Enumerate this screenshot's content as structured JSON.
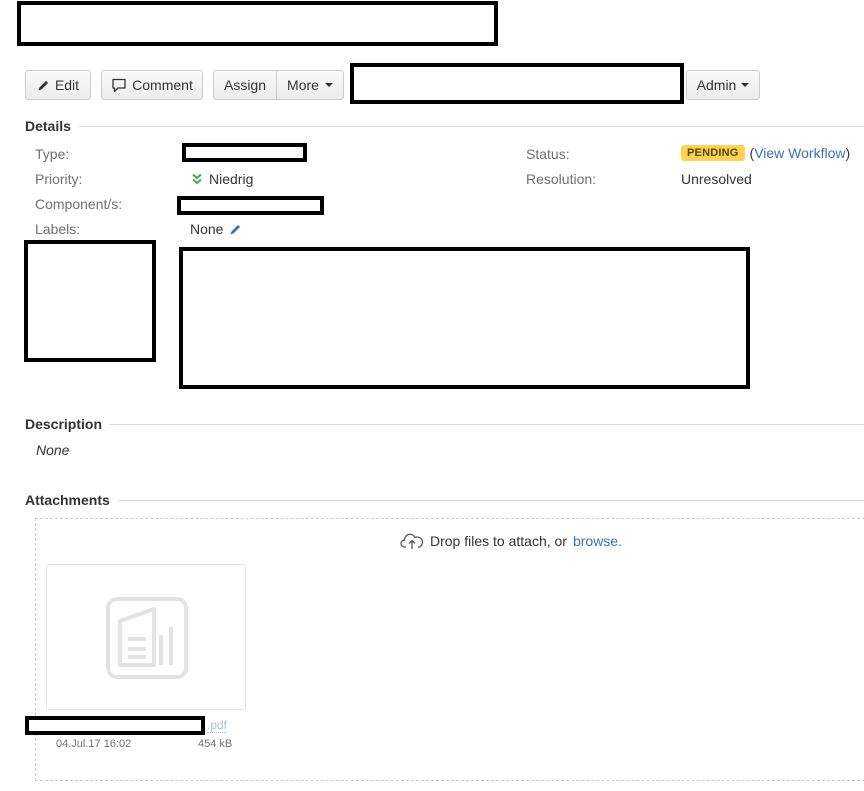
{
  "toolbar": {
    "edit_label": "Edit",
    "comment_label": "Comment",
    "assign_label": "Assign",
    "more_label": "More",
    "admin_label": "Admin"
  },
  "details": {
    "title": "Details",
    "type_label": "Type:",
    "priority_label": "Priority:",
    "priority_value": "Niedrig",
    "components_label": "Component/s:",
    "labels_label": "Labels:",
    "labels_value": "None",
    "status_label": "Status:",
    "status_value": "PENDING",
    "view_workflow_open": "(",
    "view_workflow_label": "View Workflow",
    "view_workflow_close": ")",
    "resolution_label": "Resolution:",
    "resolution_value": "Unresolved"
  },
  "description": {
    "title": "Description",
    "value": "None"
  },
  "attachments": {
    "title": "Attachments",
    "drop_text": "Drop files to attach, or",
    "browse_label": "browse.",
    "files": [
      {
        "name_suffix": ".pdf",
        "date": "04.Jul.17 16:02",
        "size": "454 kB"
      }
    ]
  },
  "colors": {
    "link": "#3b73af",
    "lozenge_bg": "#ffd351",
    "priority_green": "#3fae49"
  },
  "icons": {
    "edit": "pencil-icon",
    "comment": "speech-bubble-icon",
    "priority": "double-chevron-down-icon",
    "labels_edit": "pencil-icon",
    "upload": "cloud-upload-icon",
    "file_thumb": "document-icon"
  }
}
